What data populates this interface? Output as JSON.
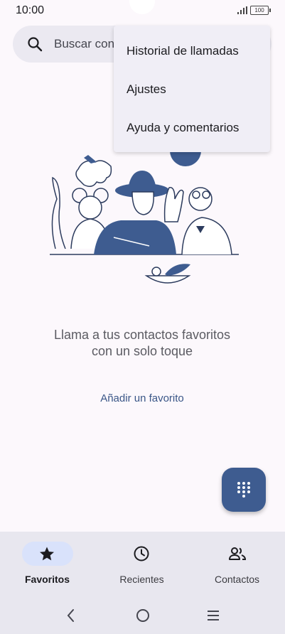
{
  "status": {
    "time": "10:00",
    "battery": "100"
  },
  "search": {
    "placeholder": "Buscar contactos"
  },
  "menu": {
    "items": [
      {
        "label": "Historial de llamadas"
      },
      {
        "label": "Ajustes"
      },
      {
        "label": "Ayuda y comentarios"
      }
    ]
  },
  "empty_state": {
    "message": "Llama a tus contactos favoritos con un solo toque",
    "action": "Añadir un favorito"
  },
  "bottom_nav": {
    "items": [
      {
        "label": "Favoritos",
        "icon": "star-icon",
        "active": true
      },
      {
        "label": "Recientes",
        "icon": "clock-icon",
        "active": false
      },
      {
        "label": "Contactos",
        "icon": "people-icon",
        "active": false
      }
    ]
  },
  "colors": {
    "accent": "#3e5c90",
    "link": "#3a5687",
    "nav_active": "#d9e2fb"
  }
}
